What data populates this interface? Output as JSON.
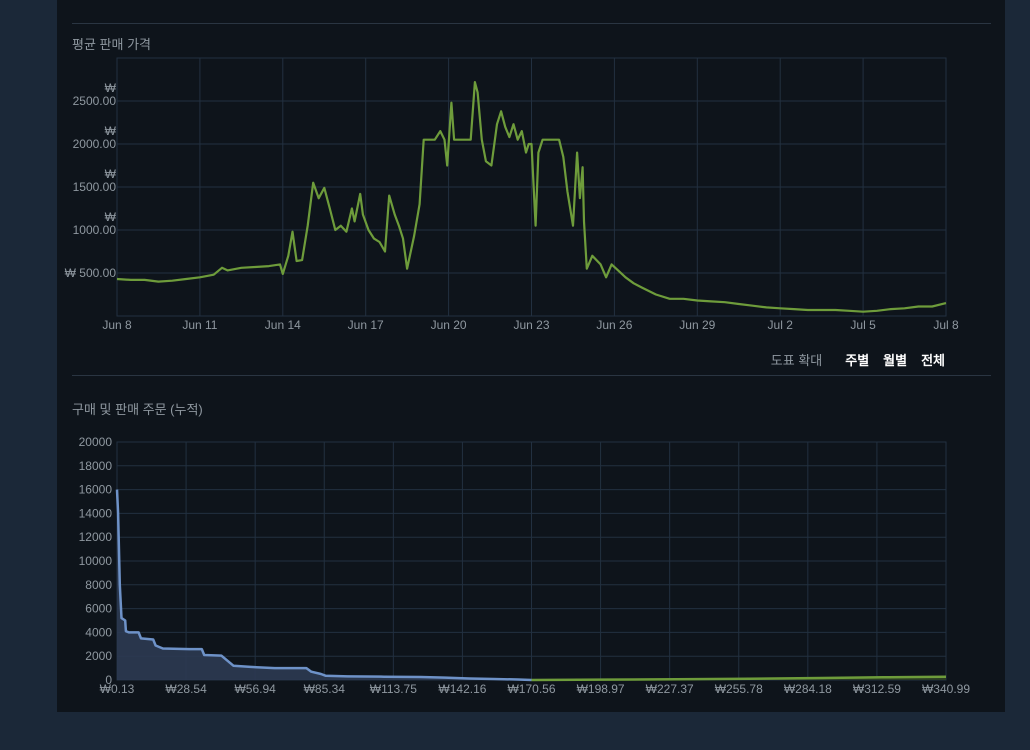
{
  "price_section": {
    "title": "평균 판매 가격",
    "zoom_label": "도표 확대",
    "zoom_options": [
      "주별",
      "월별",
      "전체"
    ]
  },
  "orders_section": {
    "title": "구매 및 판매 주문 (누적)"
  },
  "colors": {
    "background": "#1b2838",
    "panel": "#0e141b",
    "price_line": "#6e9c3b",
    "buy_line": "#6e92c8",
    "buy_fill": "#2c3a52",
    "sell_line": "#6e9c3b",
    "grid": "#223040"
  },
  "chart_data": [
    {
      "type": "line",
      "title": "평균 판매 가격",
      "x_tick_labels": [
        "Jun 8",
        "Jun 11",
        "Jun 14",
        "Jun 17",
        "Jun 20",
        "Jun 23",
        "Jun 26",
        "Jun 29",
        "Jul 2",
        "Jul 5",
        "Jul 8"
      ],
      "xlim": [
        0,
        30
      ],
      "ylim": [
        0,
        3000
      ],
      "y_ticks": [
        {
          "value": 500,
          "line1": "₩ 500.00",
          "line2": ""
        },
        {
          "value": 1000,
          "line1": "₩",
          "line2": "1000.00"
        },
        {
          "value": 1500,
          "line1": "₩",
          "line2": "1500.00"
        },
        {
          "value": 2000,
          "line1": "₩",
          "line2": "2000.00"
        },
        {
          "value": 2500,
          "line1": "₩",
          "line2": "2500.00"
        }
      ],
      "grid": true,
      "series": [
        {
          "points": [
            [
              0,
              430
            ],
            [
              0.5,
              420
            ],
            [
              1,
              420
            ],
            [
              1.5,
              400
            ],
            [
              2,
              410
            ],
            [
              2.5,
              430
            ],
            [
              3,
              450
            ],
            [
              3.5,
              480
            ],
            [
              3.8,
              560
            ],
            [
              4,
              530
            ],
            [
              4.5,
              560
            ],
            [
              5,
              570
            ],
            [
              5.5,
              580
            ],
            [
              5.9,
              600
            ],
            [
              6,
              490
            ],
            [
              6.2,
              700
            ],
            [
              6.35,
              980
            ],
            [
              6.5,
              640
            ],
            [
              6.7,
              650
            ],
            [
              6.9,
              1050
            ],
            [
              7.1,
              1550
            ],
            [
              7.3,
              1370
            ],
            [
              7.5,
              1490
            ],
            [
              7.7,
              1250
            ],
            [
              7.9,
              1000
            ],
            [
              8.1,
              1050
            ],
            [
              8.3,
              980
            ],
            [
              8.5,
              1250
            ],
            [
              8.6,
              1100
            ],
            [
              8.8,
              1420
            ],
            [
              8.9,
              1180
            ],
            [
              9.1,
              1000
            ],
            [
              9.3,
              900
            ],
            [
              9.5,
              860
            ],
            [
              9.7,
              750
            ],
            [
              9.85,
              1400
            ],
            [
              10.05,
              1180
            ],
            [
              10.2,
              1050
            ],
            [
              10.35,
              900
            ],
            [
              10.5,
              550
            ],
            [
              10.75,
              930
            ],
            [
              10.95,
              1300
            ],
            [
              11.1,
              2050
            ],
            [
              11.3,
              2050
            ],
            [
              11.5,
              2050
            ],
            [
              11.7,
              2150
            ],
            [
              11.85,
              2050
            ],
            [
              11.95,
              1750
            ],
            [
              12.1,
              2480
            ],
            [
              12.2,
              2050
            ],
            [
              12.4,
              2050
            ],
            [
              12.6,
              2050
            ],
            [
              12.8,
              2050
            ],
            [
              12.95,
              2720
            ],
            [
              13.05,
              2600
            ],
            [
              13.2,
              2050
            ],
            [
              13.35,
              1800
            ],
            [
              13.55,
              1750
            ],
            [
              13.75,
              2230
            ],
            [
              13.9,
              2380
            ],
            [
              14.05,
              2200
            ],
            [
              14.2,
              2080
            ],
            [
              14.35,
              2230
            ],
            [
              14.5,
              2050
            ],
            [
              14.65,
              2150
            ],
            [
              14.8,
              1900
            ],
            [
              14.9,
              2000
            ],
            [
              15.0,
              2000
            ],
            [
              15.15,
              1050
            ],
            [
              15.25,
              1900
            ],
            [
              15.4,
              2050
            ],
            [
              15.6,
              2050
            ],
            [
              15.8,
              2050
            ],
            [
              15.9,
              2050
            ],
            [
              16.0,
              2050
            ],
            [
              16.15,
              1850
            ],
            [
              16.3,
              1450
            ],
            [
              16.5,
              1050
            ],
            [
              16.65,
              1900
            ],
            [
              16.75,
              1370
            ],
            [
              16.85,
              1730
            ],
            [
              16.9,
              1100
            ],
            [
              17.0,
              550
            ],
            [
              17.2,
              700
            ],
            [
              17.5,
              600
            ],
            [
              17.7,
              450
            ],
            [
              17.9,
              600
            ],
            [
              18.1,
              540
            ],
            [
              18.4,
              450
            ],
            [
              18.7,
              380
            ],
            [
              19,
              330
            ],
            [
              19.5,
              250
            ],
            [
              20,
              200
            ],
            [
              20.5,
              200
            ],
            [
              21,
              180
            ],
            [
              21.5,
              170
            ],
            [
              22,
              160
            ],
            [
              22.5,
              140
            ],
            [
              23,
              120
            ],
            [
              23.5,
              100
            ],
            [
              24,
              90
            ],
            [
              24.5,
              80
            ],
            [
              25,
              70
            ],
            [
              25.5,
              70
            ],
            [
              26,
              70
            ],
            [
              26.5,
              60
            ],
            [
              27,
              50
            ],
            [
              27.5,
              60
            ],
            [
              28,
              80
            ],
            [
              28.5,
              90
            ],
            [
              29,
              110
            ],
            [
              29.5,
              110
            ],
            [
              30,
              150
            ]
          ]
        }
      ]
    },
    {
      "type": "area",
      "title": "구매 및 판매 주문 (누적)",
      "x_tick_labels": [
        "₩0.13",
        "₩28.54",
        "₩56.94",
        "₩85.34",
        "₩113.75",
        "₩142.16",
        "₩170.56",
        "₩198.97",
        "₩227.37",
        "₩255.78",
        "₩284.18",
        "₩312.59",
        "₩340.99"
      ],
      "xlim": [
        0.13,
        340.99
      ],
      "ylim": [
        0,
        20000
      ],
      "y_ticks": [
        0,
        2000,
        4000,
        6000,
        8000,
        10000,
        12000,
        14000,
        16000,
        18000,
        20000
      ],
      "grid": true,
      "series": [
        {
          "points": [
            [
              0.13,
              16000
            ],
            [
              0.6,
              14000
            ],
            [
              1.3,
              8000
            ],
            [
              2,
              5200
            ],
            [
              3.5,
              5000
            ],
            [
              3.8,
              4100
            ],
            [
              5,
              4000
            ],
            [
              9,
              4000
            ],
            [
              10,
              3500
            ],
            [
              15,
              3400
            ],
            [
              16,
              2900
            ],
            [
              19,
              2650
            ],
            [
              30,
              2600
            ],
            [
              35,
              2600
            ],
            [
              36,
              2100
            ],
            [
              43,
              2050
            ],
            [
              48,
              1200
            ],
            [
              55,
              1100
            ],
            [
              65,
              1000
            ],
            [
              78,
              1000
            ],
            [
              80,
              700
            ],
            [
              84,
              500
            ],
            [
              86,
              350
            ],
            [
              95,
              300
            ],
            [
              110,
              280
            ],
            [
              125,
              250
            ],
            [
              135,
              200
            ],
            [
              145,
              130
            ],
            [
              155,
              80
            ],
            [
              165,
              40
            ],
            [
              170.56,
              0
            ]
          ]
        },
        {
          "points": [
            [
              170.56,
              0
            ],
            [
              180,
              10
            ],
            [
              200,
              30
            ],
            [
              230,
              60
            ],
            [
              260,
              110
            ],
            [
              290,
              170
            ],
            [
              315,
              230
            ],
            [
              340.99,
              280
            ]
          ]
        }
      ]
    }
  ]
}
